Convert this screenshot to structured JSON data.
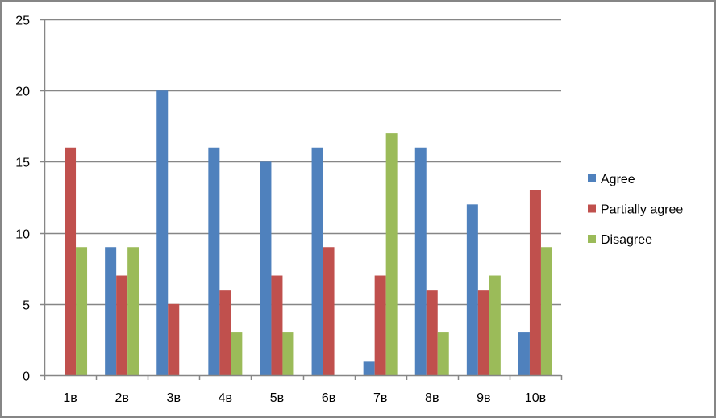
{
  "chart_data": {
    "type": "bar",
    "title": "",
    "xlabel": "",
    "ylabel": "",
    "categories": [
      "1в",
      "2в",
      "3в",
      "4в",
      "5в",
      "6в",
      "7в",
      "8в",
      "9в",
      "10в"
    ],
    "series": [
      {
        "name": "Agree",
        "color": "#4F81BD",
        "values": [
          0,
          9,
          20,
          16,
          15,
          16,
          1,
          16,
          12,
          3
        ]
      },
      {
        "name": "Partially agree",
        "color": "#C0504D",
        "values": [
          16,
          7,
          5,
          6,
          7,
          9,
          7,
          6,
          6,
          13
        ]
      },
      {
        "name": "Disagree",
        "color": "#9BBB59",
        "values": [
          9,
          9,
          0,
          3,
          3,
          0,
          17,
          3,
          7,
          9
        ]
      }
    ],
    "ylim": [
      0,
      25
    ],
    "yticks": [
      "0",
      "5",
      "10",
      "15",
      "20",
      "25"
    ],
    "grid": true,
    "legend": "right"
  }
}
